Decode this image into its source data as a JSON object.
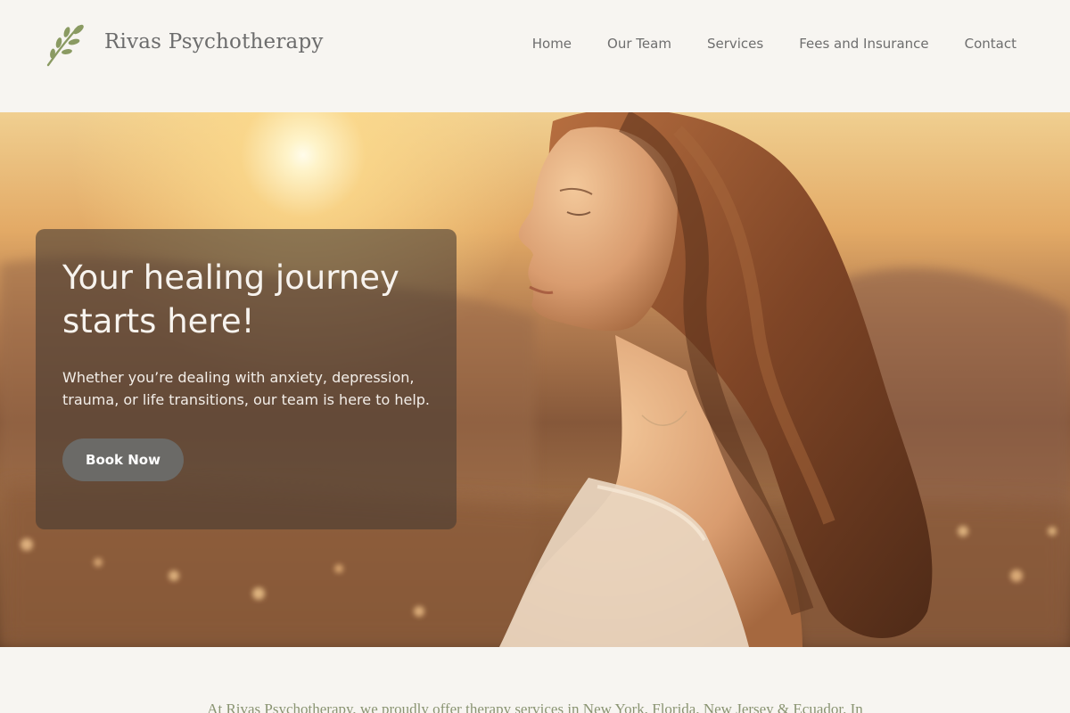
{
  "brand": {
    "name": "Rivas Psychotherapy",
    "logo_icon": "olive-branch-icon"
  },
  "nav": {
    "items": [
      {
        "label": "Home"
      },
      {
        "label": "Our Team"
      },
      {
        "label": "Services"
      },
      {
        "label": "Fees and Insurance"
      },
      {
        "label": "Contact"
      }
    ]
  },
  "hero": {
    "title": "Your healing journey starts here!",
    "subtitle": "Whether you’re dealing with anxiety, depression, trauma, or life transitions, our team is here to help.",
    "cta_label": "Book Now"
  },
  "intro": {
    "text": "At Rivas Psychotherapy, we proudly offer therapy services in New York, Florida, New Jersey & Ecuador. In"
  },
  "colors": {
    "background": "#f7f5f1",
    "accent_green": "#8a9a62",
    "button": "#6b6a67",
    "nav_text": "#6e6e6e"
  }
}
